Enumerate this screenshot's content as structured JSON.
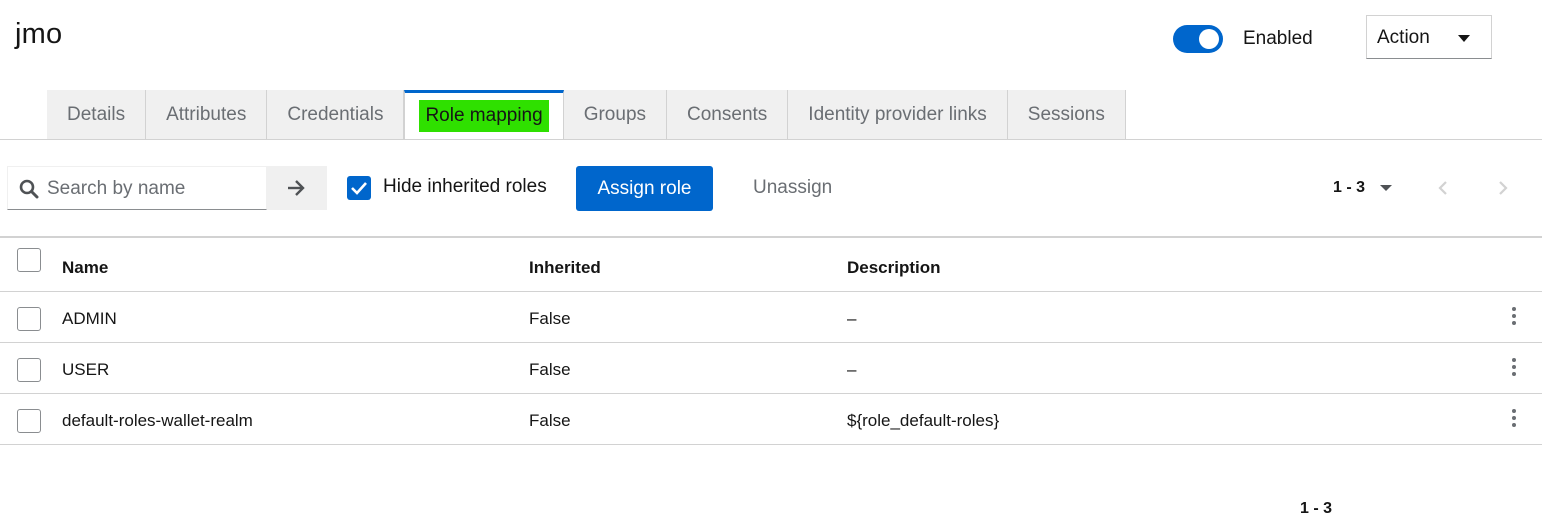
{
  "header": {
    "title": "jmo",
    "toggle_label": "Enabled",
    "toggle_on": true,
    "action_label": "Action"
  },
  "tabs": [
    {
      "label": "Details",
      "active": false
    },
    {
      "label": "Attributes",
      "active": false
    },
    {
      "label": "Credentials",
      "active": false
    },
    {
      "label": "Role mapping",
      "active": true
    },
    {
      "label": "Groups",
      "active": false
    },
    {
      "label": "Consents",
      "active": false
    },
    {
      "label": "Identity provider links",
      "active": false
    },
    {
      "label": "Sessions",
      "active": false
    }
  ],
  "toolbar": {
    "search_placeholder": "Search by name",
    "hide_inherited_label": "Hide inherited roles",
    "hide_inherited_checked": true,
    "assign_label": "Assign role",
    "unassign_label": "Unassign",
    "pagination": "1 - 3"
  },
  "table": {
    "columns": [
      "Name",
      "Inherited",
      "Description"
    ],
    "rows": [
      {
        "name": "ADMIN",
        "inherited": "False",
        "description": "–"
      },
      {
        "name": "USER",
        "inherited": "False",
        "description": "–"
      },
      {
        "name": "default-roles-wallet-realm",
        "inherited": "False",
        "description": "${role_default-roles}"
      }
    ]
  },
  "colors": {
    "primary": "#0066cc",
    "highlight": "#2fe000"
  },
  "icons": {
    "search": "search-icon",
    "go": "arrow-right-icon",
    "caret": "caret-down-icon",
    "prev": "chevron-left-icon",
    "next": "chevron-right-icon",
    "row_actions": "kebab-icon"
  }
}
